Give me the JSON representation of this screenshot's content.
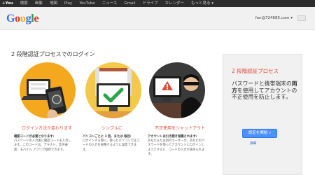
{
  "topbar": {
    "items": [
      "+You",
      "検索",
      "画像",
      "地図",
      "Play",
      "YouTube",
      "ニュース",
      "Gmail",
      "ドライブ",
      "カレンダー",
      "もっと見る ▾"
    ]
  },
  "header": {
    "logo_letters": [
      "G",
      "o",
      "o",
      "g",
      "l",
      "e"
    ],
    "logo_colors": [
      "#3b73d8",
      "#d93a2b",
      "#efb01a",
      "#3b73d8",
      "#2f9a45",
      "#d93a2b"
    ],
    "account_email": "fan@724685.com ▾"
  },
  "main": {
    "title": "2 段階認証プロセスでのログイン",
    "features": [
      {
        "caption": "ログイン方法が変わります",
        "desc_title": "確認コードが必要となります:",
        "desc": "パスワードの入力後に確認コードを入力します。このコードは、テキスト、音声通話、モバイル アプリで取得できます。"
      },
      {
        "caption": "シンプルに",
        "desc_title": "パソコンごとに 1 回、または 毎回:",
        "desc": "ログインする際に、使ったパソコンではコードの入力を省略するように設定できます。"
      },
      {
        "caption": "不正使用をシャットアウト",
        "desc_title": "アカウントは引き続き保護されます:",
        "desc": "あなたまたは別のユーザーが、あなたのパスワードを使ってアカウントにログインしようとすると、コードの入力が求められます。"
      }
    ]
  },
  "side": {
    "title": "2 段階認証プロセス",
    "body_before": "パスワードと携帯端末の",
    "body_emph": "両方",
    "body_after": "を使用してアカウントの不正使用を防止します。",
    "start_button": "設定を開始 »",
    "details_link": "詳細"
  },
  "colors": {
    "accent_red": "#dd4b39",
    "button_blue": "#4d90fe"
  }
}
